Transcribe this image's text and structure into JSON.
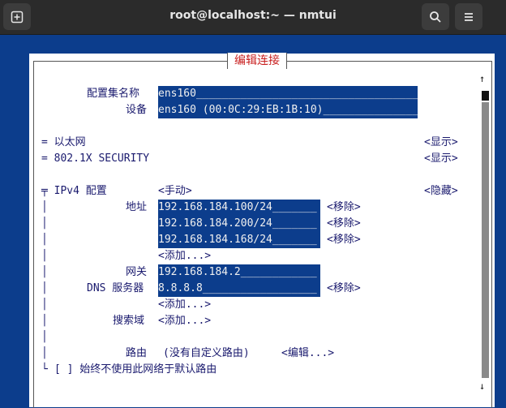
{
  "window": {
    "title": "root@localhost:~ — nmtui"
  },
  "dialog": {
    "title": "编辑连接",
    "profile_name_label": "配置集名称",
    "profile_name_value": "ens160",
    "device_label": "设备",
    "device_value": "ens160 (00:0C:29:EB:1B:10)",
    "ethernet": {
      "label": "= 以太网",
      "action": "<显示>"
    },
    "security8021x": {
      "label": "= 802.1X SECURITY",
      "action": "<显示>"
    },
    "ipv4": {
      "label": "╤ IPv4 配置",
      "mode": "<手动>",
      "action": "<隐藏>",
      "addresses_label": "地址",
      "addresses": [
        {
          "value": "192.168.184.100/24",
          "remove": "<移除>"
        },
        {
          "value": "192.168.184.200/24",
          "remove": "<移除>"
        },
        {
          "value": "192.168.184.168/24",
          "remove": "<移除>"
        }
      ],
      "add_address": "<添加...>",
      "gateway_label": "网关",
      "gateway_value": "192.168.184.2",
      "dns_label": "DNS 服务器",
      "dns_value": "8.8.8.8",
      "dns_remove": "<移除>",
      "add_dns": "<添加...>",
      "search_label": "搜索域",
      "add_search": "<添加...>",
      "routing_label": "路由",
      "routing_value": "(没有自定义路由)",
      "routing_edit": "<编辑...>",
      "never_default": "[ ] 始终不使用此网络于默认路由"
    }
  }
}
